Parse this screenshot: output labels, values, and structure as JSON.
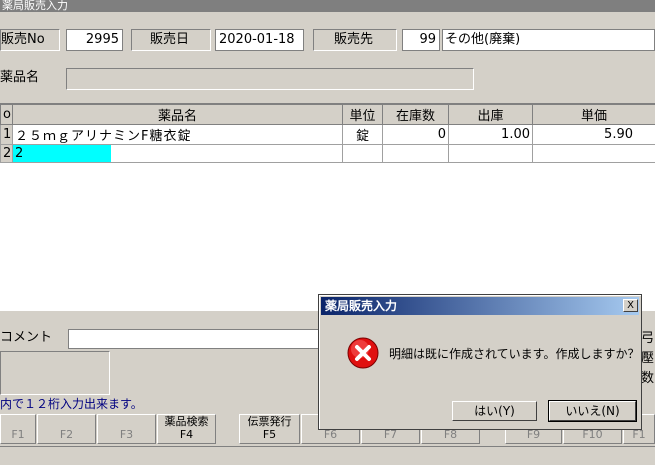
{
  "window": {
    "title": "薬局販売入力"
  },
  "header": {
    "sale_no_label": "販売No",
    "sale_no": "2995",
    "sale_date_label": "販売日",
    "sale_date": "2020-01-18",
    "customer_label": "販売先",
    "customer_code": "99",
    "customer_name": "その他(廃棄)",
    "drug_name_label": "薬品名",
    "drug_name": ""
  },
  "grid": {
    "headers": [
      "o",
      "薬品名",
      "単位",
      "在庫数",
      "出庫",
      "単価"
    ],
    "rows": [
      {
        "no": "1",
        "name": "２５ｍｇアリナミンF糖衣錠",
        "unit": "錠",
        "stock": "0",
        "out": "1.00",
        "price": "5.90"
      },
      {
        "no": "2",
        "name": "2",
        "unit": "",
        "stock": "",
        "out": "",
        "price": ""
      }
    ]
  },
  "comment": {
    "label": "コメント",
    "value": "",
    "right_chars": [
      "弓",
      "壓",
      "数"
    ]
  },
  "status_text": "内で１２桁入力出来ます。",
  "fkeys": [
    {
      "label": "",
      "key": "F1"
    },
    {
      "label": "",
      "key": "F2"
    },
    {
      "label": "",
      "key": "F3"
    },
    {
      "label": "薬品検索",
      "key": "F4"
    },
    {
      "label": "伝票発行",
      "key": "F5"
    },
    {
      "label": "",
      "key": "F6"
    },
    {
      "label": "",
      "key": "F7"
    },
    {
      "label": "",
      "key": "F8"
    },
    {
      "label": "",
      "key": "F9"
    },
    {
      "label": "",
      "key": "F10"
    },
    {
      "label": "",
      "key": "F1"
    }
  ],
  "dialog": {
    "title": "薬局販売入力",
    "close": "X",
    "message": "明細は既に作成されています。作成しますか？",
    "yes_label": "はい(Y)",
    "no_label": "いいえ(N)",
    "icon": "error-icon",
    "icon_color": "#e01010"
  }
}
